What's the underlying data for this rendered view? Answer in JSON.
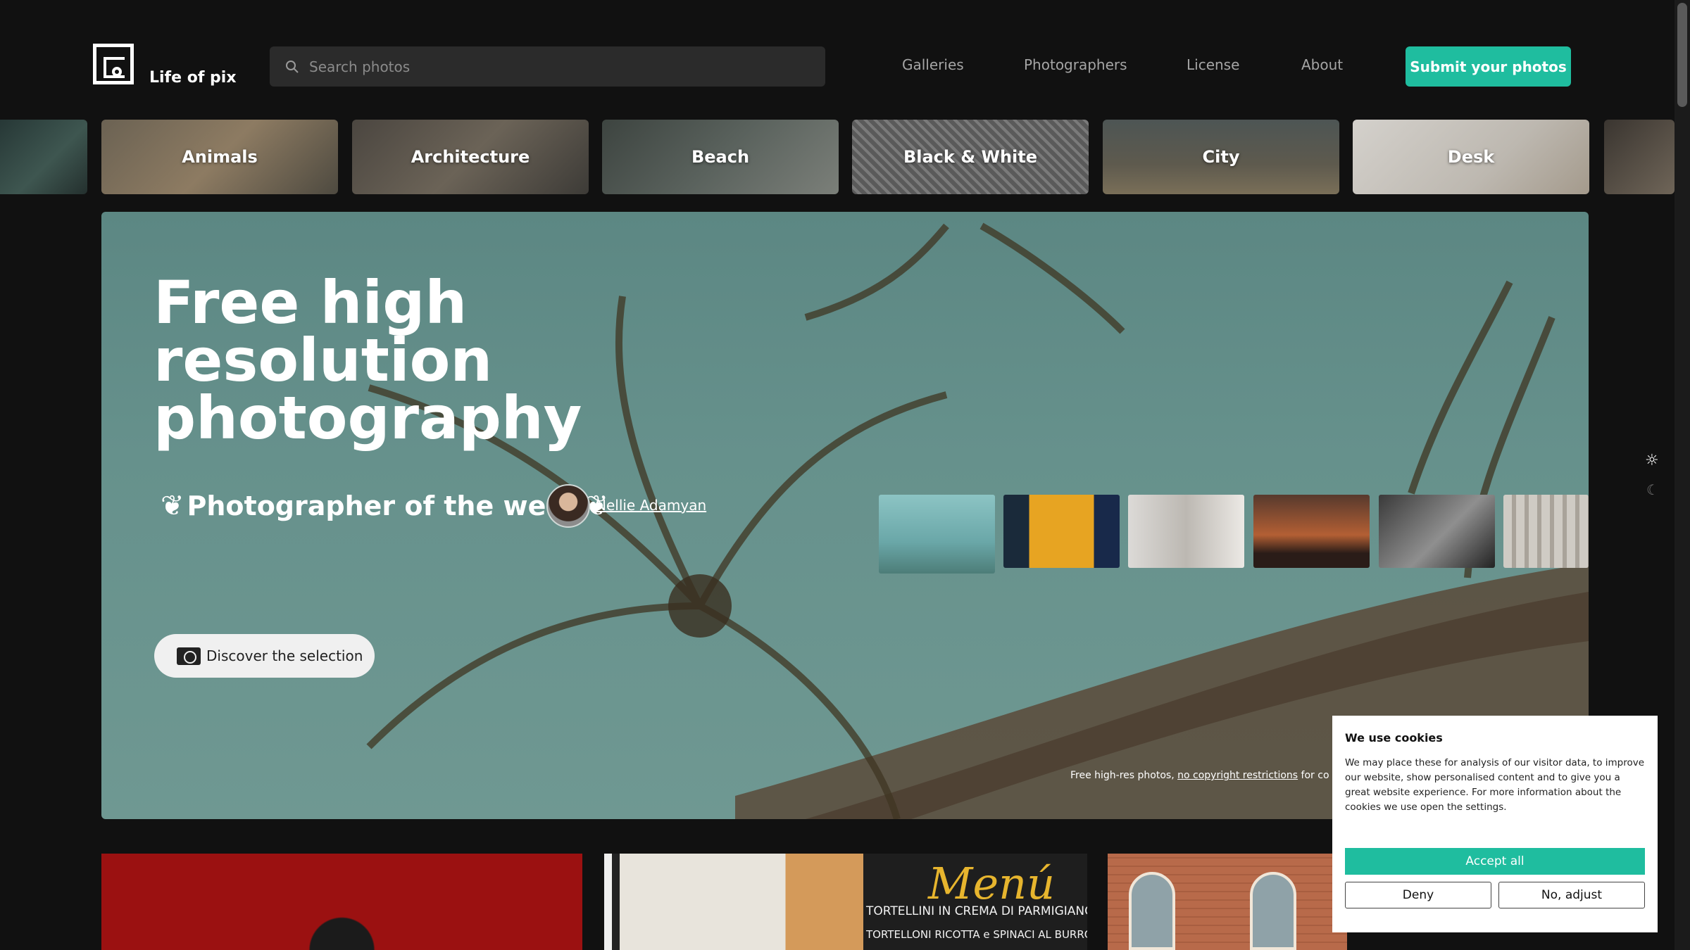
{
  "header": {
    "brand": "Life of pix",
    "search_placeholder": "Search photos",
    "nav": [
      "Galleries",
      "Photographers",
      "License",
      "About"
    ],
    "submit_label": "Submit your photos"
  },
  "categories": [
    "Animals",
    "Architecture",
    "Beach",
    "Black & White",
    "City",
    "Desk"
  ],
  "hero": {
    "title": "Free high resolution photography",
    "potw_label": "Photographer of the week",
    "photographer": "Nellie Adamyan",
    "discover_label": "Discover the selection",
    "caption_prefix": "Free high-res photos,",
    "caption_link": "no copyright restrictions",
    "caption_suffix": "for co"
  },
  "cookie": {
    "title": "We use cookies",
    "body": "We may place these for analysis of our visitor data, to improve our website, show personalised content and to give you a great website experience. For more information about the cookies we use open the settings.",
    "accept": "Accept all",
    "deny": "Deny",
    "adjust": "No, adjust"
  },
  "bottom_tiles": {
    "menu_title": "Menú",
    "menu_lines": [
      "TORTELLINI IN CREMA DI PARMIGIANO",
      "TORTELLONI RICOTTA e SPINACI AL BURRO e RAGÙ"
    ]
  },
  "colors": {
    "accent": "#1fbd9f",
    "background": "#111111"
  }
}
